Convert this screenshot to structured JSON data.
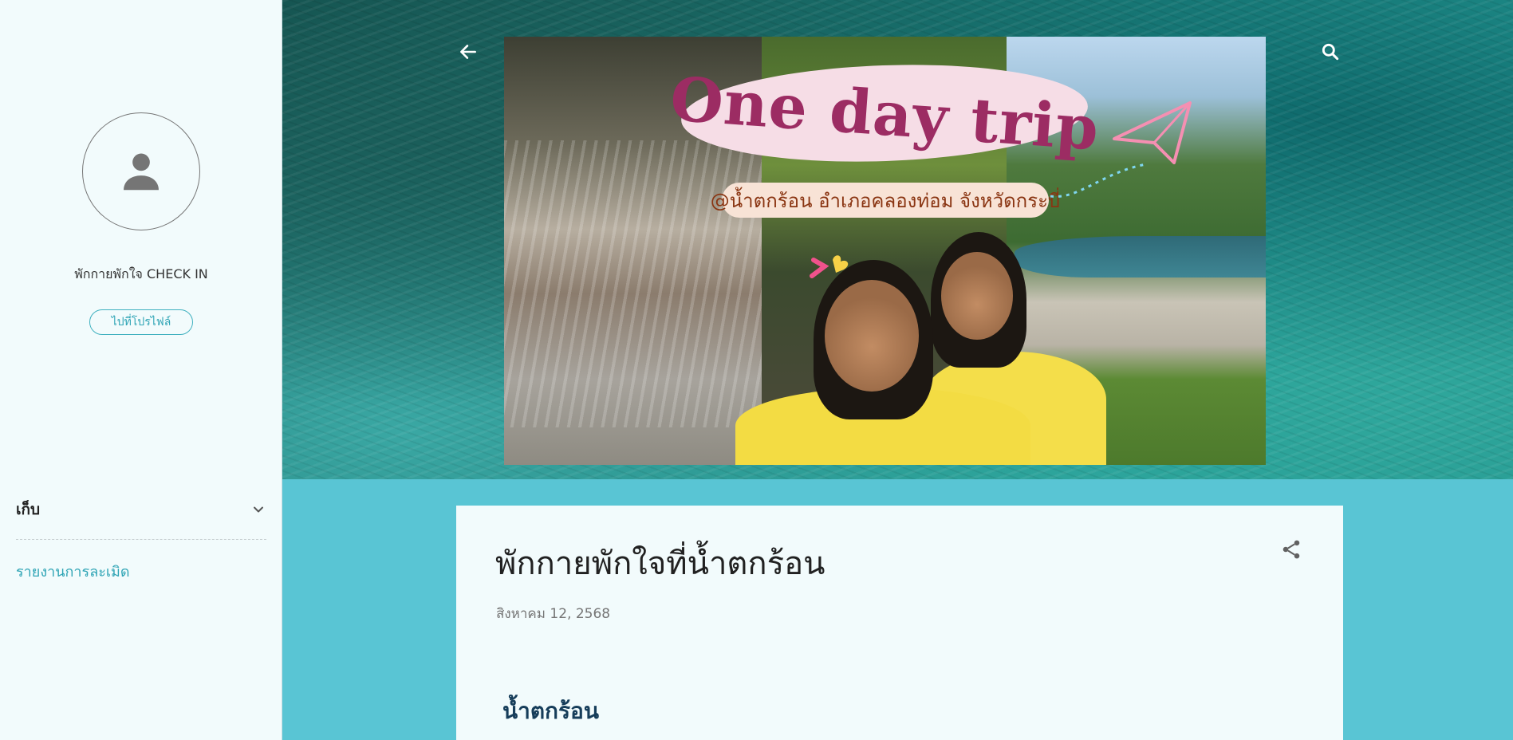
{
  "sidebar": {
    "avatar_icon": "person-icon",
    "profile_name": "พักกายพักใจ CHECK IN",
    "profile_button": "ไปที่โปรไฟล์",
    "archive_label": "เก็บ",
    "archive_icon": "chevron-down-icon",
    "report_link": "รายงานการละเมิด"
  },
  "header": {
    "back_icon": "arrow-back-icon",
    "search_icon": "search-icon"
  },
  "banner": {
    "title": "One day trip",
    "subtitle": "@น้ำตกร้อน อำเภอคลองท่อม จังหวัดกระบี่"
  },
  "post": {
    "title": "พักกายพักใจที่น้ำตกร้อน",
    "date": "สิงหาคม 12, 2568",
    "share_icon": "share-icon",
    "section_heading": "น้ำตกร้อน"
  },
  "colors": {
    "accent": "#2ea4b5",
    "page_background": "#59c5d4",
    "sidebar_background": "#f2fbfc",
    "banner_title": "#9c2c63"
  }
}
